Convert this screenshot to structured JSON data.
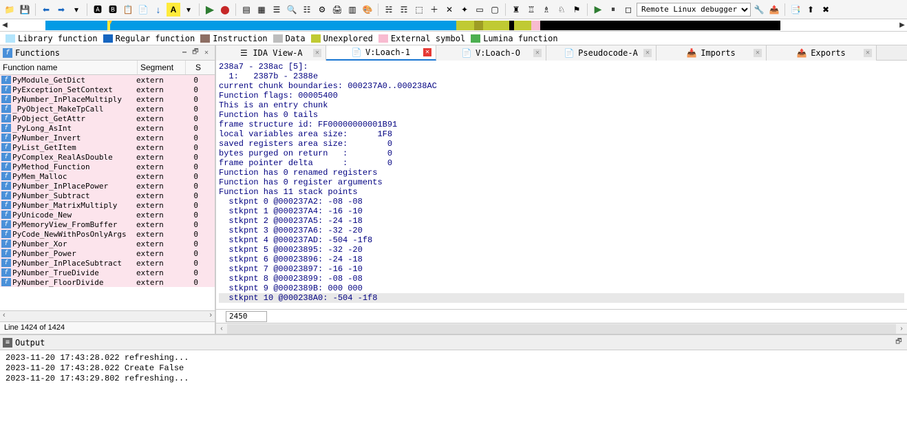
{
  "toolbar": {
    "debugger_options": [
      "Remote Linux debugger"
    ],
    "debugger_selected": "Remote Linux debugger"
  },
  "legend": [
    {
      "color": "#b3e5fc",
      "label": "Library function"
    },
    {
      "color": "#1565c0",
      "label": "Regular function"
    },
    {
      "color": "#8d6e63",
      "label": "Instruction"
    },
    {
      "color": "#bdbdbd",
      "label": "Data"
    },
    {
      "color": "#c0ca33",
      "label": "Unexplored"
    },
    {
      "color": "#f8bbd0",
      "label": "External symbol"
    },
    {
      "color": "#4caf50",
      "label": "Lumina function"
    }
  ],
  "functions_panel": {
    "title": "Functions",
    "columns": [
      "Function name",
      "Segment",
      "S"
    ],
    "rows": [
      {
        "name": "PyModule_GetDict",
        "seg": "extern",
        "s": "0"
      },
      {
        "name": "PyException_SetContext",
        "seg": "extern",
        "s": "0"
      },
      {
        "name": "PyNumber_InPlaceMultiply",
        "seg": "extern",
        "s": "0"
      },
      {
        "name": "_PyObject_MakeTpCall",
        "seg": "extern",
        "s": "0"
      },
      {
        "name": "PyObject_GetAttr",
        "seg": "extern",
        "s": "0"
      },
      {
        "name": "_PyLong_AsInt",
        "seg": "extern",
        "s": "0"
      },
      {
        "name": "PyNumber_Invert",
        "seg": "extern",
        "s": "0"
      },
      {
        "name": "PyList_GetItem",
        "seg": "extern",
        "s": "0"
      },
      {
        "name": "PyComplex_RealAsDouble",
        "seg": "extern",
        "s": "0"
      },
      {
        "name": "PyMethod_Function",
        "seg": "extern",
        "s": "0"
      },
      {
        "name": "PyMem_Malloc",
        "seg": "extern",
        "s": "0"
      },
      {
        "name": "PyNumber_InPlacePower",
        "seg": "extern",
        "s": "0"
      },
      {
        "name": "PyNumber_Subtract",
        "seg": "extern",
        "s": "0"
      },
      {
        "name": "PyNumber_MatrixMultiply",
        "seg": "extern",
        "s": "0"
      },
      {
        "name": "PyUnicode_New",
        "seg": "extern",
        "s": "0"
      },
      {
        "name": "PyMemoryView_FromBuffer",
        "seg": "extern",
        "s": "0"
      },
      {
        "name": "PyCode_NewWithPosOnlyArgs",
        "seg": "extern",
        "s": "0"
      },
      {
        "name": "PyNumber_Xor",
        "seg": "extern",
        "s": "0"
      },
      {
        "name": "PyNumber_Power",
        "seg": "extern",
        "s": "0"
      },
      {
        "name": "PyNumber_InPlaceSubtract",
        "seg": "extern",
        "s": "0"
      },
      {
        "name": "PyNumber_TrueDivide",
        "seg": "extern",
        "s": "0"
      },
      {
        "name": "PyNumber_FloorDivide",
        "seg": "extern",
        "s": "0"
      }
    ],
    "status": "Line 1424 of 1424"
  },
  "view_tabs": [
    {
      "id": "ida-view-a",
      "label": "IDA View-A",
      "icon": "list"
    },
    {
      "id": "v-loach-1",
      "label": "V:Loach-1",
      "icon": "doc",
      "active": true
    },
    {
      "id": "v-loach-o",
      "label": "V:Loach-O",
      "icon": "doc"
    },
    {
      "id": "pseudocode-a",
      "label": "Pseudocode-A",
      "icon": "doc"
    },
    {
      "id": "imports",
      "label": "Imports",
      "icon": "import"
    },
    {
      "id": "exports",
      "label": "Exports",
      "icon": "export"
    }
  ],
  "code_lines": [
    "238a7 - 238ac [5]:",
    "  1:   2387b - 2388e",
    "current chunk boundaries: 000237A0..000238AC",
    "Function flags: 00005400",
    "This is an entry chunk",
    "Function has 0 tails",
    "frame structure id: FF00000000001B91",
    "local variables area size:      1F8",
    "saved registers area size:        0",
    "bytes purged on return   :        0",
    "frame pointer delta      :        0",
    "Function has 0 renamed registers",
    "Function has 0 register arguments",
    "Function has 11 stack points",
    "  stkpnt 0 @000237A2: -08 -08",
    "  stkpnt 1 @000237A4: -16 -10",
    "  stkpnt 2 @000237A5: -24 -18",
    "  stkpnt 3 @000237A6: -32 -20",
    "  stkpnt 4 @000237AD: -504 -1f8",
    "  stkpnt 5 @00023895: -32 -20",
    "  stkpnt 6 @00023896: -24 -18",
    "  stkpnt 7 @00023897: -16 -10",
    "  stkpnt 8 @00023899: -08 -08",
    "  stkpnt 9 @0002389B: 000 000"
  ],
  "code_highlight": "  stkpnt 10 @000238A0: -504 -1f8",
  "input_value": "2450",
  "output": {
    "title": "Output",
    "lines": [
      "2023-11-20 17:43:28.022 refreshing...",
      "2023-11-20 17:43:28.022 Create False",
      "2023-11-20 17:43:29.802 refreshing..."
    ]
  }
}
